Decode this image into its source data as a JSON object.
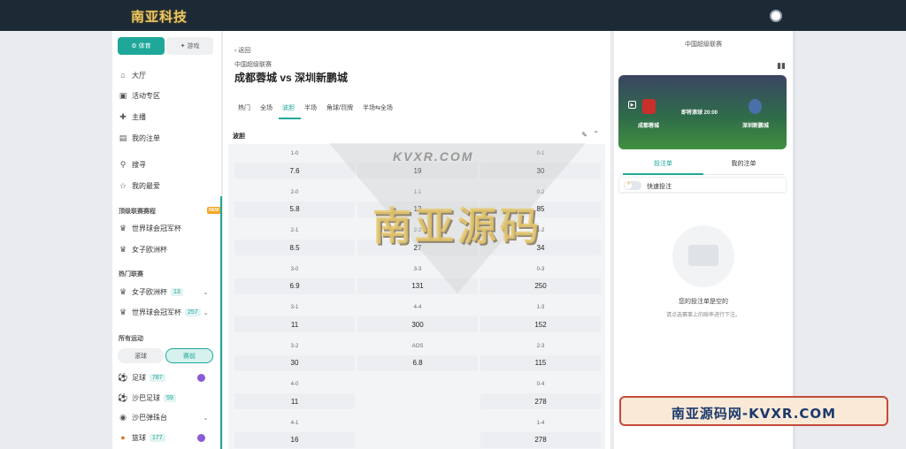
{
  "topbar": {
    "logo_text": "南亚科技"
  },
  "sidebar": {
    "tabs": [
      {
        "label": "体育",
        "icon": "sports-icon"
      },
      {
        "label": "游戏",
        "icon": "gamepad-icon"
      }
    ],
    "nav": [
      {
        "label": "大厅",
        "icon": "home-icon"
      },
      {
        "label": "活动专区",
        "icon": "gift-icon"
      },
      {
        "label": "主播",
        "icon": "streamer-icon"
      },
      {
        "label": "我的注单",
        "icon": "receipt-icon"
      },
      {
        "label": "搜寻",
        "icon": "search-icon"
      },
      {
        "label": "我的最爱",
        "icon": "star-icon"
      }
    ],
    "top_leagues_title": "顶级联赛赛程",
    "top_leagues_badge": "NEW",
    "top_leagues": [
      {
        "label": "世界球会冠军杯"
      },
      {
        "label": "女子欧洲杯"
      }
    ],
    "hot_title": "热门联赛",
    "hot": [
      {
        "label": "女子欧洲杯",
        "count": "13"
      },
      {
        "label": "世界球会冠军杯",
        "count": "257"
      }
    ],
    "all_sports_title": "所有运动",
    "toggle": [
      "滚球",
      "赛前"
    ],
    "sports": [
      {
        "label": "足球",
        "count": "787"
      },
      {
        "label": "沙巴足球",
        "count": "59"
      },
      {
        "label": "沙巴弹珠台",
        "count": ""
      },
      {
        "label": "篮球",
        "count": "177"
      }
    ]
  },
  "main": {
    "back": "返回",
    "league": "中国超级联赛",
    "title": "成都蓉城 vs 深圳新鹏城",
    "tabs": [
      "热门",
      "全场",
      "波胆",
      "半场",
      "角球/罚牌",
      "半场⇆全场"
    ],
    "section_title": "波胆",
    "rows": [
      {
        "l": "1-0",
        "lv": "7.6",
        "m": "",
        "mv": "19",
        "r": "0-1",
        "rv": "30"
      },
      {
        "l": "2-0",
        "lv": "5.8",
        "m": "1-1",
        "mv": "12",
        "r": "0-2",
        "rv": "85"
      },
      {
        "l": "2-1",
        "lv": "8.5",
        "m": "2-2",
        "mv": "27",
        "r": "1-2",
        "rv": "34"
      },
      {
        "l": "3-0",
        "lv": "6.9",
        "m": "3-3",
        "mv": "131",
        "r": "0-3",
        "rv": "250"
      },
      {
        "l": "3-1",
        "lv": "11",
        "m": "4-4",
        "mv": "300",
        "r": "1-3",
        "rv": "152"
      },
      {
        "l": "3-2",
        "lv": "30",
        "m": "AOS",
        "mv": "6.8",
        "r": "2-3",
        "rv": "115"
      },
      {
        "l": "4-0",
        "lv": "11",
        "m": "",
        "mv": "",
        "r": "0-4",
        "rv": "278"
      },
      {
        "l": "4-1",
        "lv": "16",
        "m": "",
        "mv": "",
        "r": "1-4",
        "rv": "278"
      }
    ]
  },
  "right": {
    "league": "中国超级联赛",
    "home": "成都蓉城",
    "away": "深圳新鹏城",
    "time": "即将滚球 20:00",
    "tabs": [
      "投注单",
      "我的注单"
    ],
    "quick_bet": "快速投注",
    "empty_title": "您的投注单是空的",
    "empty_sub": "请点选赛事上的赔率进行下注。"
  },
  "watermark": {
    "url": "KVXR.COM",
    "big": "南亚源码"
  },
  "stamp": {
    "text": "南亚源码网-KVXR.COM"
  },
  "colors": {
    "accent": "#1fa89a",
    "topbar": "#1c2a36"
  }
}
